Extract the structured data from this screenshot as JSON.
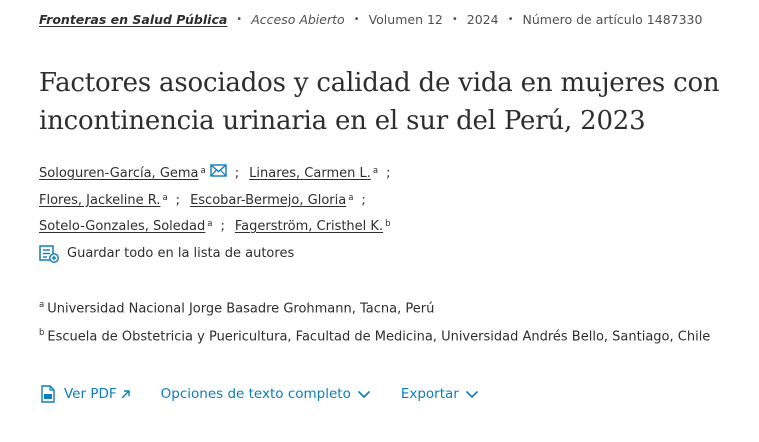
{
  "journal": {
    "name": "Fronteras en Salud Pública",
    "access": "Acceso Abierto",
    "volume": "Volumen 12",
    "year": "2024",
    "article_number": "Número de artículo 1487330"
  },
  "title": "Factores asociados y calidad de vida en mujeres con incontinencia urinaria en el sur del Perú, 2023",
  "authors": [
    {
      "name": "Sologuren-García, Gema",
      "aff": "a"
    },
    {
      "name": "Linares, Carmen L.",
      "aff": "a"
    },
    {
      "name": "Flores, Jackeline R.",
      "aff": "a"
    },
    {
      "name": "Escobar-Bermejo, Gloria",
      "aff": "a"
    },
    {
      "name": "Sotelo-Gonzales, Soledad",
      "aff": "a"
    },
    {
      "name": "Fagerström, Cristhel K.",
      "aff": "b"
    }
  ],
  "separator": ";",
  "save_all_label": "Guardar todo en la lista de autores",
  "affiliations": [
    {
      "key": "a",
      "text": "Universidad Nacional Jorge Basadre Grohmann, Tacna, Perú"
    },
    {
      "key": "b",
      "text": "Escuela de Obstetricia y Puericultura, Facultad de Medicina, Universidad Andrés Bello, Santiago, Chile"
    }
  ],
  "actions": {
    "pdf": "Ver PDF",
    "full_text": "Opciones de texto completo",
    "export": "Exportar"
  },
  "colors": {
    "link": "#0c7dbb",
    "text": "#2e2e2e"
  },
  "icons": {
    "mail": "envelope-icon",
    "save": "list-add-icon",
    "pdf": "pdf-file-icon",
    "external": "arrow-up-right-icon",
    "chevron": "chevron-down-icon"
  }
}
